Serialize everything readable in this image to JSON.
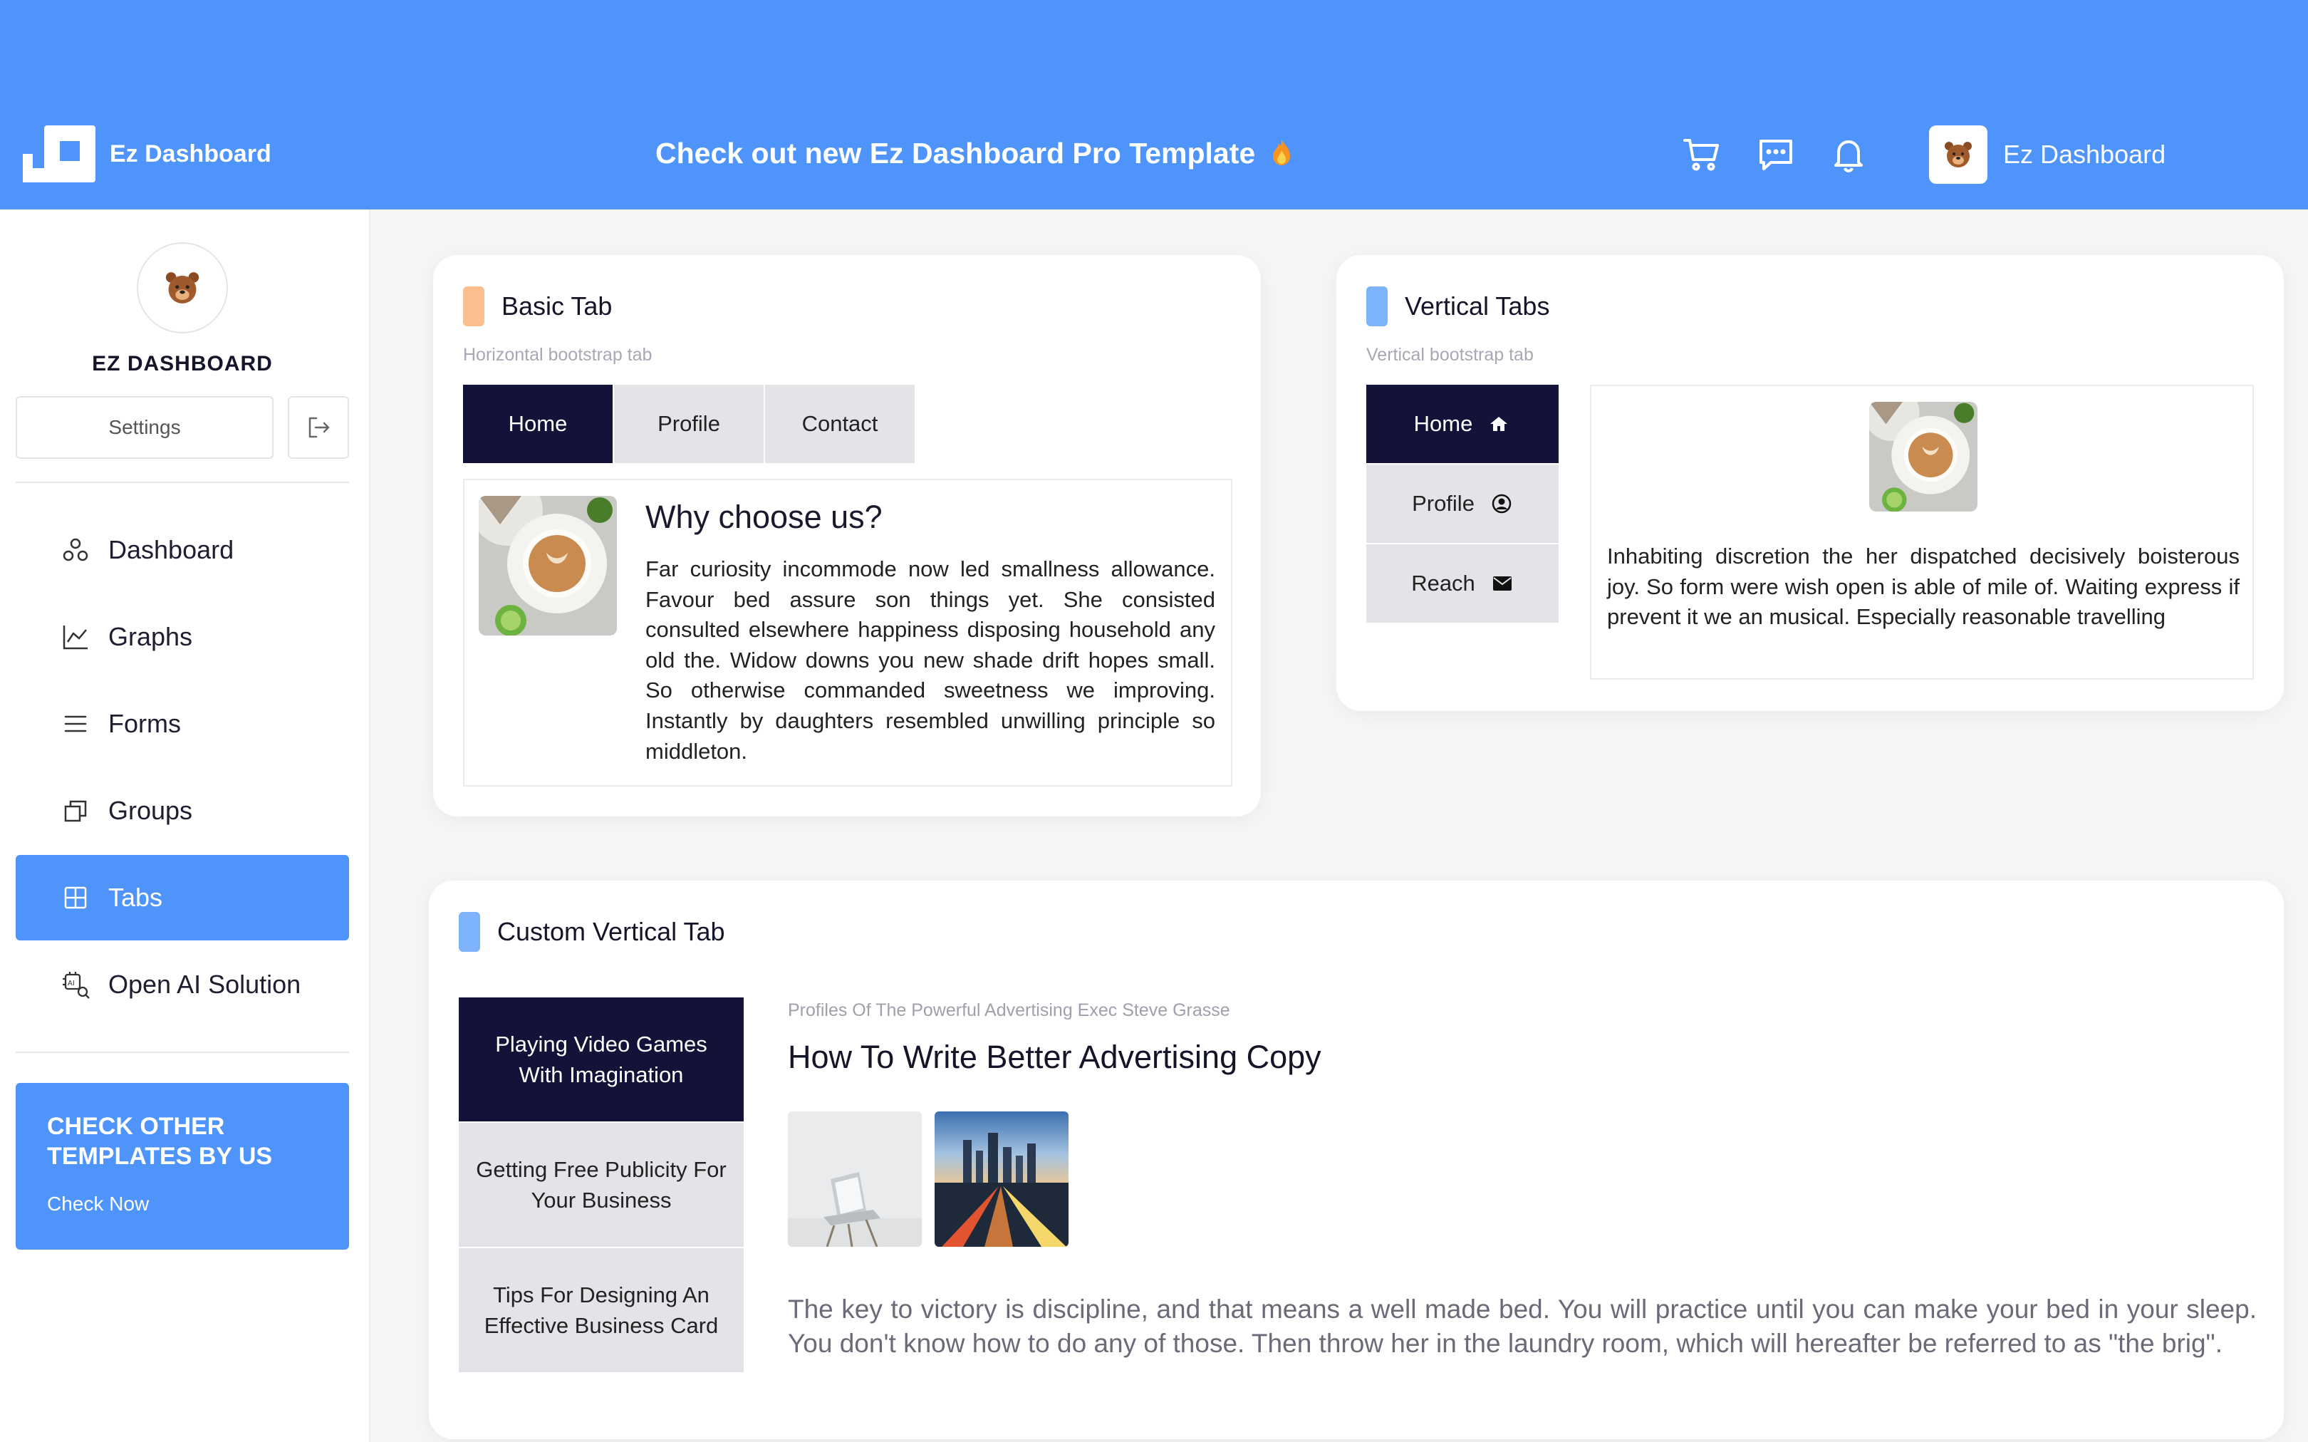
{
  "header": {
    "brand": "Ez Dashboard",
    "promo": "Check out new Ez Dashboard Pro Template",
    "user_name": "Ez Dashboard",
    "icons": [
      "cart-icon",
      "chat-icon",
      "bell-icon"
    ]
  },
  "sidebar": {
    "brand": "EZ DASHBOARD",
    "settings_label": "Settings",
    "items": [
      {
        "label": "Dashboard",
        "icon": "dashboard-icon"
      },
      {
        "label": "Graphs",
        "icon": "graph-icon"
      },
      {
        "label": "Forms",
        "icon": "forms-icon"
      },
      {
        "label": "Groups",
        "icon": "groups-icon"
      },
      {
        "label": "Tabs",
        "icon": "tabs-icon",
        "active": true
      },
      {
        "label": "Open AI Solution",
        "icon": "ai-icon"
      }
    ],
    "promo_title": "CHECK OTHER TEMPLATES BY US",
    "promo_link": "Check Now"
  },
  "basic_tab": {
    "title": "Basic Tab",
    "subtitle": "Horizontal bootstrap tab",
    "tabs": [
      "Home",
      "Profile",
      "Contact"
    ],
    "heading": "Why choose us?",
    "text": "Far curiosity incommode now led smallness allowance. Favour bed assure son things yet. She consisted consulted elsewhere happiness disposing household any old the. Widow downs you new shade drift hopes small. So otherwise commanded sweetness we improving. Instantly by daughters resembled unwilling principle so middleton."
  },
  "vertical_tabs": {
    "title": "Vertical Tabs",
    "subtitle": "Vertical bootstrap tab",
    "tabs": [
      {
        "label": "Home",
        "icon": "home-icon"
      },
      {
        "label": "Profile",
        "icon": "user-circle-icon"
      },
      {
        "label": "Reach",
        "icon": "envelope-icon"
      }
    ],
    "text": "Inhabiting discretion the her dispatched decisively boisterous joy. So form were wish open is able of mile of. Waiting express if prevent it we an musical. Especially reasonable travelling"
  },
  "custom_tab": {
    "title": "Custom Vertical Tab",
    "tabs": [
      "Playing Video Games With Imagination",
      "Getting Free Publicity For Your Business",
      "Tips For Designing An Effective Business Card"
    ],
    "subtitle": "Profiles Of The Powerful Advertising Exec Steve Grasse",
    "heading": "How To Write Better Advertising Copy",
    "text": "The key to victory is discipline, and that means a well made bed. You will practice until you can make your bed in your sleep. You don't know how to do any of those. Then throw her in the laundry room, which will hereafter be referred to as \"the brig\"."
  },
  "colors": {
    "accent": "#4f94fb",
    "dark_tab": "#13133a",
    "orange_bar": "#fbc08f",
    "blue_bar": "#7db3fb"
  }
}
